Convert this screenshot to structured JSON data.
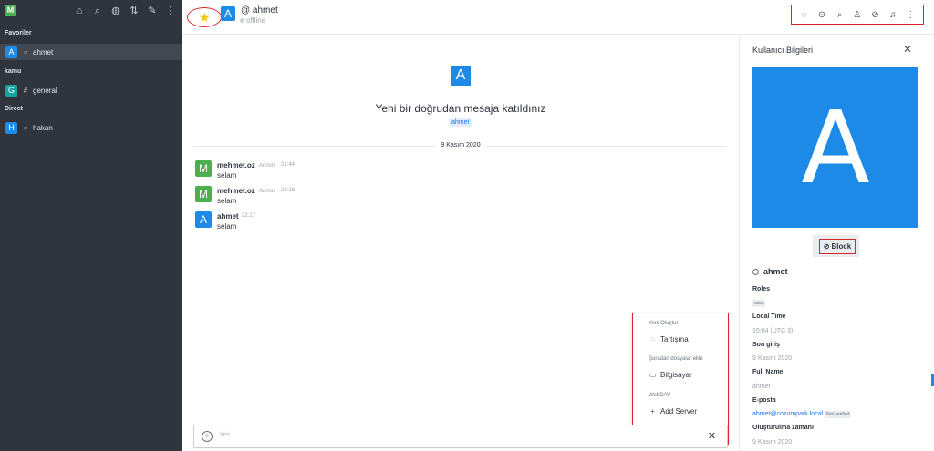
{
  "sidebar": {
    "logo_letter": "M",
    "icons": [
      "home-icon",
      "search-icon",
      "globe-icon",
      "sort-icon",
      "edit-icon",
      "kebab-icon"
    ],
    "sections": [
      {
        "title": "Favoriler",
        "items": [
          {
            "avatar": "A",
            "avatar_color": "#1d8ae8",
            "symbol": "○",
            "label": "ahmet",
            "active": true
          }
        ]
      },
      {
        "title": "kamu",
        "items": [
          {
            "avatar": "G",
            "avatar_color": "#12a5a0",
            "symbol": "#",
            "label": "general",
            "active": false
          }
        ]
      },
      {
        "title": "Direct",
        "items": [
          {
            "avatar": "H",
            "avatar_color": "#1d8ae8",
            "symbol": "○",
            "label": "hakan",
            "active": false
          }
        ]
      }
    ]
  },
  "header": {
    "avatar": "A",
    "name": "@ ahmet",
    "status": "offline",
    "toolbar_icons": [
      "discussion-icon",
      "thread-icon",
      "search-icon",
      "user-info-icon",
      "attachment-icon",
      "bell-icon",
      "kebab-icon"
    ]
  },
  "chat": {
    "intro_avatar": "A",
    "intro_text": "Yeni bir doğrudan mesaja katıldınız",
    "intro_tag": "ahmet",
    "date_divider": "9 Kasım 2020",
    "messages": [
      {
        "avatar": "M",
        "avatar_color": "#4caf50",
        "user": "mehmet.oz",
        "role": "Admin",
        "time": "21:44",
        "text": "selam"
      },
      {
        "avatar": "M",
        "avatar_color": "#4caf50",
        "user": "mehmet.oz",
        "role": "Admin",
        "time": "22:16",
        "text": "selam"
      },
      {
        "avatar": "A",
        "avatar_color": "#1d8ae8",
        "user": "ahmet",
        "role": "",
        "time": "22:17",
        "text": "selam"
      }
    ],
    "composer_placeholder": "Ileti"
  },
  "popup": {
    "section_new": "Yeni Oluştur",
    "discussion": "Tartışma",
    "section_upload": "Şuradan dosyalar ekle",
    "computer": "Bilgisayar",
    "section_webdav": "WebDAV",
    "add_server": "Add Server"
  },
  "panel": {
    "title": "Kullanıcı Bilgileri",
    "avatar_letter": "A",
    "block_label": "Block",
    "username": "ahmet",
    "roles_label": "Roles",
    "role": "user",
    "local_time_label": "Local Time",
    "local_time": "10:04 (UTC 3)",
    "last_login_label": "Son giriş",
    "last_login": "9 Kasım 2020",
    "full_name_label": "Full Name",
    "full_name": "ahmet",
    "email_label": "E-posta",
    "email": "ahmet@cozumpark.local",
    "email_status": "Not verified",
    "created_label": "Oluşturulma zamanı",
    "created": "9 Kasım 2020"
  }
}
